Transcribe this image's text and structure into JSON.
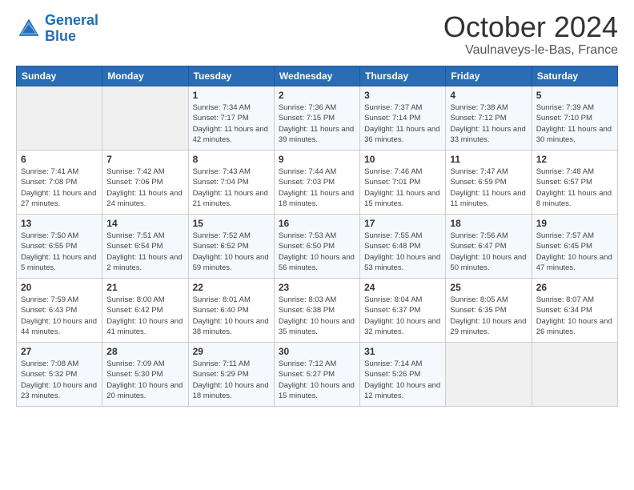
{
  "header": {
    "logo_line1": "General",
    "logo_line2": "Blue",
    "month": "October 2024",
    "location": "Vaulnaveys-le-Bas, France"
  },
  "weekdays": [
    "Sunday",
    "Monday",
    "Tuesday",
    "Wednesday",
    "Thursday",
    "Friday",
    "Saturday"
  ],
  "weeks": [
    [
      {
        "num": "",
        "sunrise": "",
        "sunset": "",
        "daylight": ""
      },
      {
        "num": "",
        "sunrise": "",
        "sunset": "",
        "daylight": ""
      },
      {
        "num": "1",
        "sunrise": "Sunrise: 7:34 AM",
        "sunset": "Sunset: 7:17 PM",
        "daylight": "Daylight: 11 hours and 42 minutes."
      },
      {
        "num": "2",
        "sunrise": "Sunrise: 7:36 AM",
        "sunset": "Sunset: 7:15 PM",
        "daylight": "Daylight: 11 hours and 39 minutes."
      },
      {
        "num": "3",
        "sunrise": "Sunrise: 7:37 AM",
        "sunset": "Sunset: 7:14 PM",
        "daylight": "Daylight: 11 hours and 36 minutes."
      },
      {
        "num": "4",
        "sunrise": "Sunrise: 7:38 AM",
        "sunset": "Sunset: 7:12 PM",
        "daylight": "Daylight: 11 hours and 33 minutes."
      },
      {
        "num": "5",
        "sunrise": "Sunrise: 7:39 AM",
        "sunset": "Sunset: 7:10 PM",
        "daylight": "Daylight: 11 hours and 30 minutes."
      }
    ],
    [
      {
        "num": "6",
        "sunrise": "Sunrise: 7:41 AM",
        "sunset": "Sunset: 7:08 PM",
        "daylight": "Daylight: 11 hours and 27 minutes."
      },
      {
        "num": "7",
        "sunrise": "Sunrise: 7:42 AM",
        "sunset": "Sunset: 7:06 PM",
        "daylight": "Daylight: 11 hours and 24 minutes."
      },
      {
        "num": "8",
        "sunrise": "Sunrise: 7:43 AM",
        "sunset": "Sunset: 7:04 PM",
        "daylight": "Daylight: 11 hours and 21 minutes."
      },
      {
        "num": "9",
        "sunrise": "Sunrise: 7:44 AM",
        "sunset": "Sunset: 7:03 PM",
        "daylight": "Daylight: 11 hours and 18 minutes."
      },
      {
        "num": "10",
        "sunrise": "Sunrise: 7:46 AM",
        "sunset": "Sunset: 7:01 PM",
        "daylight": "Daylight: 11 hours and 15 minutes."
      },
      {
        "num": "11",
        "sunrise": "Sunrise: 7:47 AM",
        "sunset": "Sunset: 6:59 PM",
        "daylight": "Daylight: 11 hours and 11 minutes."
      },
      {
        "num": "12",
        "sunrise": "Sunrise: 7:48 AM",
        "sunset": "Sunset: 6:57 PM",
        "daylight": "Daylight: 11 hours and 8 minutes."
      }
    ],
    [
      {
        "num": "13",
        "sunrise": "Sunrise: 7:50 AM",
        "sunset": "Sunset: 6:55 PM",
        "daylight": "Daylight: 11 hours and 5 minutes."
      },
      {
        "num": "14",
        "sunrise": "Sunrise: 7:51 AM",
        "sunset": "Sunset: 6:54 PM",
        "daylight": "Daylight: 11 hours and 2 minutes."
      },
      {
        "num": "15",
        "sunrise": "Sunrise: 7:52 AM",
        "sunset": "Sunset: 6:52 PM",
        "daylight": "Daylight: 10 hours and 59 minutes."
      },
      {
        "num": "16",
        "sunrise": "Sunrise: 7:53 AM",
        "sunset": "Sunset: 6:50 PM",
        "daylight": "Daylight: 10 hours and 56 minutes."
      },
      {
        "num": "17",
        "sunrise": "Sunrise: 7:55 AM",
        "sunset": "Sunset: 6:48 PM",
        "daylight": "Daylight: 10 hours and 53 minutes."
      },
      {
        "num": "18",
        "sunrise": "Sunrise: 7:56 AM",
        "sunset": "Sunset: 6:47 PM",
        "daylight": "Daylight: 10 hours and 50 minutes."
      },
      {
        "num": "19",
        "sunrise": "Sunrise: 7:57 AM",
        "sunset": "Sunset: 6:45 PM",
        "daylight": "Daylight: 10 hours and 47 minutes."
      }
    ],
    [
      {
        "num": "20",
        "sunrise": "Sunrise: 7:59 AM",
        "sunset": "Sunset: 6:43 PM",
        "daylight": "Daylight: 10 hours and 44 minutes."
      },
      {
        "num": "21",
        "sunrise": "Sunrise: 8:00 AM",
        "sunset": "Sunset: 6:42 PM",
        "daylight": "Daylight: 10 hours and 41 minutes."
      },
      {
        "num": "22",
        "sunrise": "Sunrise: 8:01 AM",
        "sunset": "Sunset: 6:40 PM",
        "daylight": "Daylight: 10 hours and 38 minutes."
      },
      {
        "num": "23",
        "sunrise": "Sunrise: 8:03 AM",
        "sunset": "Sunset: 6:38 PM",
        "daylight": "Daylight: 10 hours and 35 minutes."
      },
      {
        "num": "24",
        "sunrise": "Sunrise: 8:04 AM",
        "sunset": "Sunset: 6:37 PM",
        "daylight": "Daylight: 10 hours and 32 minutes."
      },
      {
        "num": "25",
        "sunrise": "Sunrise: 8:05 AM",
        "sunset": "Sunset: 6:35 PM",
        "daylight": "Daylight: 10 hours and 29 minutes."
      },
      {
        "num": "26",
        "sunrise": "Sunrise: 8:07 AM",
        "sunset": "Sunset: 6:34 PM",
        "daylight": "Daylight: 10 hours and 26 minutes."
      }
    ],
    [
      {
        "num": "27",
        "sunrise": "Sunrise: 7:08 AM",
        "sunset": "Sunset: 5:32 PM",
        "daylight": "Daylight: 10 hours and 23 minutes."
      },
      {
        "num": "28",
        "sunrise": "Sunrise: 7:09 AM",
        "sunset": "Sunset: 5:30 PM",
        "daylight": "Daylight: 10 hours and 20 minutes."
      },
      {
        "num": "29",
        "sunrise": "Sunrise: 7:11 AM",
        "sunset": "Sunset: 5:29 PM",
        "daylight": "Daylight: 10 hours and 18 minutes."
      },
      {
        "num": "30",
        "sunrise": "Sunrise: 7:12 AM",
        "sunset": "Sunset: 5:27 PM",
        "daylight": "Daylight: 10 hours and 15 minutes."
      },
      {
        "num": "31",
        "sunrise": "Sunrise: 7:14 AM",
        "sunset": "Sunset: 5:26 PM",
        "daylight": "Daylight: 10 hours and 12 minutes."
      },
      {
        "num": "",
        "sunrise": "",
        "sunset": "",
        "daylight": ""
      },
      {
        "num": "",
        "sunrise": "",
        "sunset": "",
        "daylight": ""
      }
    ]
  ]
}
